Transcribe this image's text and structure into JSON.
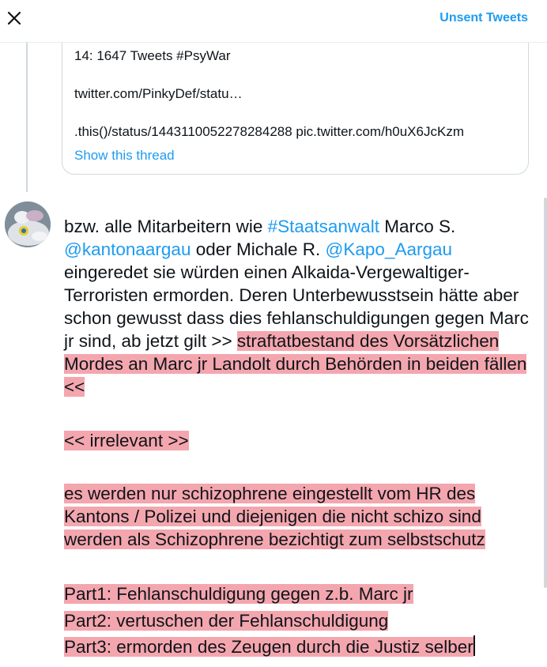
{
  "header": {
    "close_icon": "close-icon",
    "unsent_label": "Unsent Tweets"
  },
  "quoted": {
    "line1": "14: 1647 Tweets #PsyWar",
    "line2": "twitter.com/PinkyDef/statu…",
    "line3": ".this()/status/1443110052278284288 pic.twitter.com/h0uX6JcKzm",
    "show_thread": "Show this thread"
  },
  "compose": {
    "avatar": "user-avatar",
    "t1": "bzw. alle Mitarbeitern wie ",
    "hashtag": "#Staatsanwalt",
    "t2": " Marco S.",
    "mention1": "@kantonaargau",
    "t3": " oder Michale R. ",
    "mention2": "@Kapo_Aargau",
    "t4": "eingeredet sie würden einen Alkaida-Vergewaltiger-Terroristen ermorden. Deren Unterbewusstsein hätte aber schon gewusst dass dies fehlanschuldigungen gegen Marc jr sind, ab jetzt gilt >> ",
    "h1": "straftatbestand des Vorsätzlichen Mordes an Marc jr Landolt durch Behörden in beiden fällen << ",
    "h2": "<< irrelevant >>",
    "h3": "es werden nur schizophrene eingestellt vom HR des Kantons / Polizei und diejenigen die nicht schizo sind werden als Schizophrene bezichtigt zum selbstschutz",
    "part1": "Part1: Fehlanschuldigung gegen z.b. Marc jr",
    "part2": "Part2: vertuschen der Fehlanschuldigung",
    "part3": "Part3: ermorden des Zeugen durch die Justiz selber"
  },
  "colors": {
    "accent": "#1d9bf0",
    "highlight": "#f4a6ae"
  }
}
